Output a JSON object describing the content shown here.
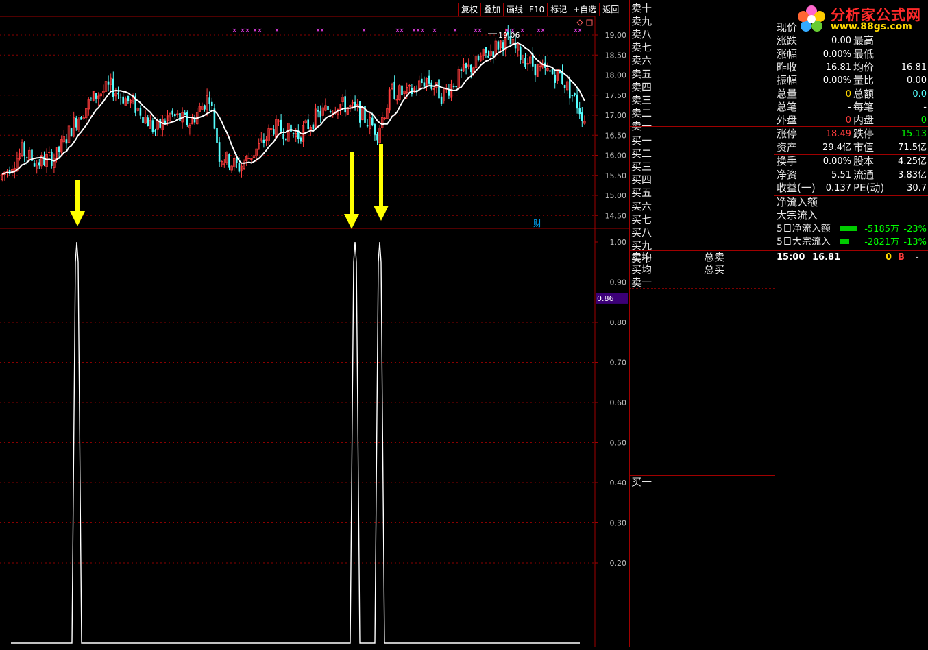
{
  "colors": {
    "up": "#ff3c3c",
    "down": "#54ffff",
    "ma": "#ffffff",
    "grid": "#8b0000",
    "axis": "#a00000",
    "arrow": "#ffff00",
    "marker": "#ff44ff",
    "label": "#c0c0c0",
    "cursor_bg": "#3c0077"
  },
  "toolbar": [
    "复权",
    "叠加",
    "画线",
    "F10",
    "标记",
    "+自选",
    "返回"
  ],
  "main_chart": {
    "yticks": [
      "19.00",
      "18.50",
      "18.00",
      "17.50",
      "17.00",
      "16.50",
      "16.00",
      "15.50",
      "15.00",
      "14.50"
    ],
    "high_label": "19.06",
    "fin_badge": "财",
    "corner_icons": [
      "diamond-icon",
      "square-icon"
    ],
    "marker_glyph": "×",
    "arrow_count": 3
  },
  "sub_chart": {
    "yticks": [
      "1.00",
      "0.90",
      "0.80",
      "0.70",
      "0.60",
      "0.50",
      "0.40",
      "0.30",
      "0.20"
    ],
    "cursor_value": "0.86"
  },
  "orderbook": {
    "levels": [
      "卖十",
      "卖九",
      "卖八",
      "卖七",
      "卖六",
      "卖五",
      "卖四",
      "卖三",
      "卖二",
      "卖一",
      "买一",
      "买二",
      "买三",
      "买四",
      "买五",
      "买六",
      "买七",
      "买八",
      "买九",
      "买十"
    ],
    "avg_sell": "卖均",
    "avg_buy": "买均",
    "total_sell": "总卖",
    "total_buy": "总买",
    "lower_sell": "卖一",
    "lower_buy": "买一"
  },
  "logo": {
    "main": "分析家公式网",
    "url": "www.88gs.com"
  },
  "quote": {
    "rows": [
      {
        "k1": "现价",
        "v1": "",
        "k2": "",
        "v2": ""
      },
      {
        "k1": "涨跌",
        "v1": "0.00",
        "k2": "最高",
        "v2": ""
      },
      {
        "k1": "涨幅",
        "v1": "0.00%",
        "k2": "最低",
        "v2": ""
      },
      {
        "k1": "昨收",
        "v1": "16.81",
        "k2": "均价",
        "v2": "16.81"
      },
      {
        "k1": "振幅",
        "v1": "0.00%",
        "k2": "量比",
        "v2": "0.00"
      },
      {
        "k1": "总量",
        "v1": "0",
        "k2": "总额",
        "v2": "0.0",
        "c1": "#ffd700",
        "c2": "#54ffff"
      },
      {
        "k1": "总笔",
        "v1": "-",
        "k2": "每笔",
        "v2": "-"
      },
      {
        "k1": "外盘",
        "v1": "0",
        "k2": "内盘",
        "v2": "0",
        "c1": "#ff3c3c",
        "c2": "#00ff00"
      }
    ],
    "limit_rows": [
      {
        "k1": "涨停",
        "v1": "18.49",
        "k2": "跌停",
        "v2": "15.13",
        "c1": "#ff3c3c",
        "c2": "#00ff00"
      },
      {
        "k1": "资产",
        "v1": "29.4亿",
        "k2": "市值",
        "v2": "71.5亿"
      }
    ],
    "fund_rows": [
      {
        "k1": "换手",
        "v1": "0.00%",
        "k2": "股本",
        "v2": "4.25亿"
      },
      {
        "k1": "净资",
        "v1": "5.51",
        "k2": "流通",
        "v2": "3.83亿"
      },
      {
        "k1": "收益(一)",
        "v1": "0.137",
        "k2": "PE(动)",
        "v2": "30.7"
      }
    ],
    "flow": {
      "net_inflow": "净流入额",
      "big_inflow": "大宗流入",
      "net5": "5日净流入额",
      "net5_val": "-5185万",
      "net5_pct": "-23%",
      "big5": "5日大宗流入",
      "big5_val": "-2821万",
      "big5_pct": "-13%"
    },
    "tick": {
      "time": "15:00",
      "price": "16.81",
      "vol": "0",
      "side": "B",
      "mark": "-"
    }
  }
}
